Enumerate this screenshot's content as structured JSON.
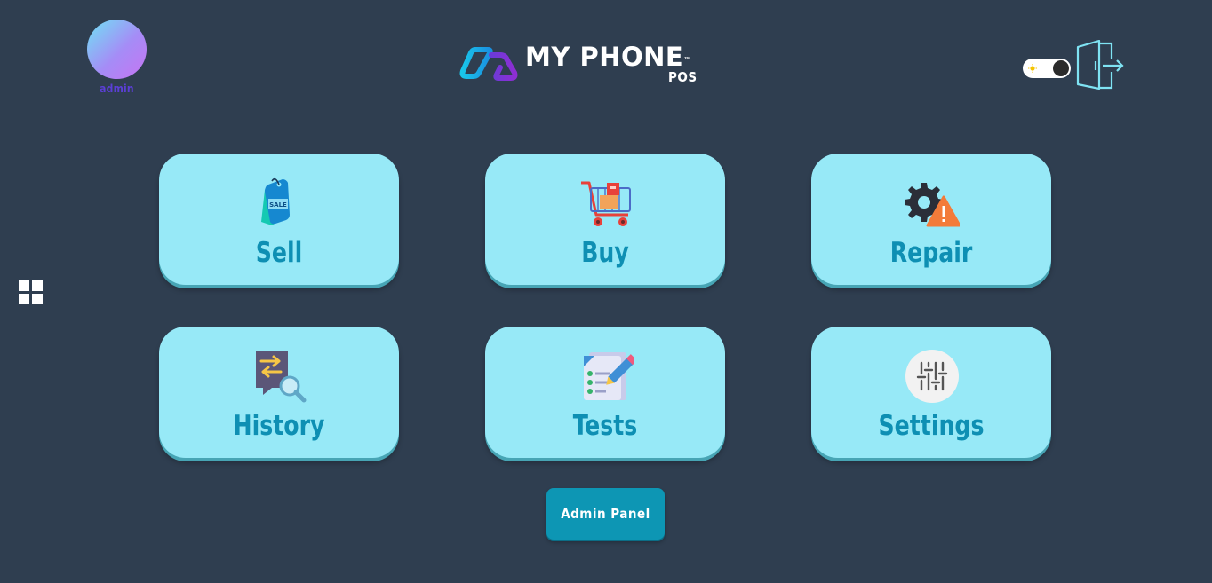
{
  "user": {
    "name": "admin"
  },
  "logo": {
    "title": "MY PHONE",
    "trademark": "™",
    "subtitle": "POS"
  },
  "header": {
    "theme_toggle": {
      "state": "light",
      "icon": "sun-icon"
    },
    "logout_icon": "door-exit-icon"
  },
  "sidebar": {
    "menu_icon": "grid-icon"
  },
  "tiles": [
    {
      "label": "Sell",
      "icon": "sale-tag-icon"
    },
    {
      "label": "Buy",
      "icon": "shopping-cart-icon"
    },
    {
      "label": "Repair",
      "icon": "gear-warning-icon"
    },
    {
      "label": "History",
      "icon": "history-search-icon"
    },
    {
      "label": "Tests",
      "icon": "checklist-pencil-icon"
    },
    {
      "label": "Settings",
      "icon": "sliders-icon"
    }
  ],
  "admin_button": {
    "label": "Admin Panel"
  },
  "colors": {
    "background": "#2f3e50",
    "tile": "#97e9f7",
    "tile_text": "#0e8fb3",
    "admin_button": "#0d96b4",
    "username": "#5b3fd6"
  }
}
